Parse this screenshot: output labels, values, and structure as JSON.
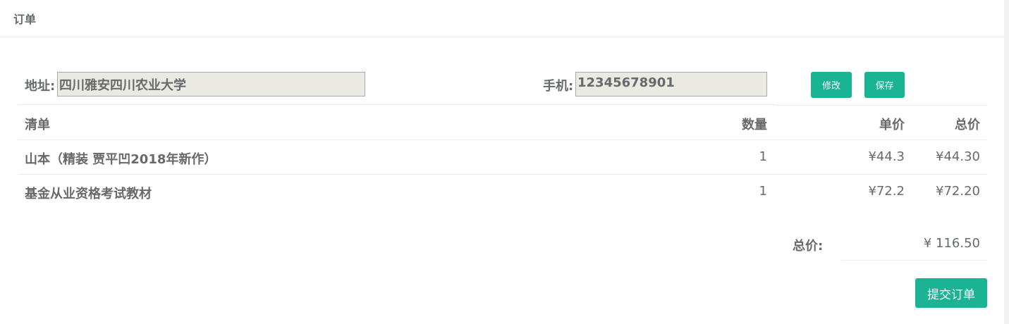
{
  "panel": {
    "title": "订单"
  },
  "address": {
    "label": "地址:",
    "value": "四川雅安四川农业大学"
  },
  "phone": {
    "label": "手机:",
    "value": "12345678901"
  },
  "buttons": {
    "edit": "修改",
    "save": "保存",
    "submit": "提交订单"
  },
  "table": {
    "headers": {
      "item": "清单",
      "qty": "数量",
      "unit_price": "单价",
      "total": "总价"
    },
    "rows": [
      {
        "item": "山本（精装 贾平凹2018年新作）",
        "qty": "1",
        "unit_price": "¥44.3",
        "total": "¥44.30"
      },
      {
        "item": "基金从业资格考试教材",
        "qty": "1",
        "unit_price": "¥72.2",
        "total": "¥72.20"
      }
    ]
  },
  "summary": {
    "label": "总价:",
    "value": "¥ 116.50"
  },
  "colors": {
    "accent": "#1ab394",
    "text": "#676a6c",
    "field_bg": "#eaeae2"
  }
}
